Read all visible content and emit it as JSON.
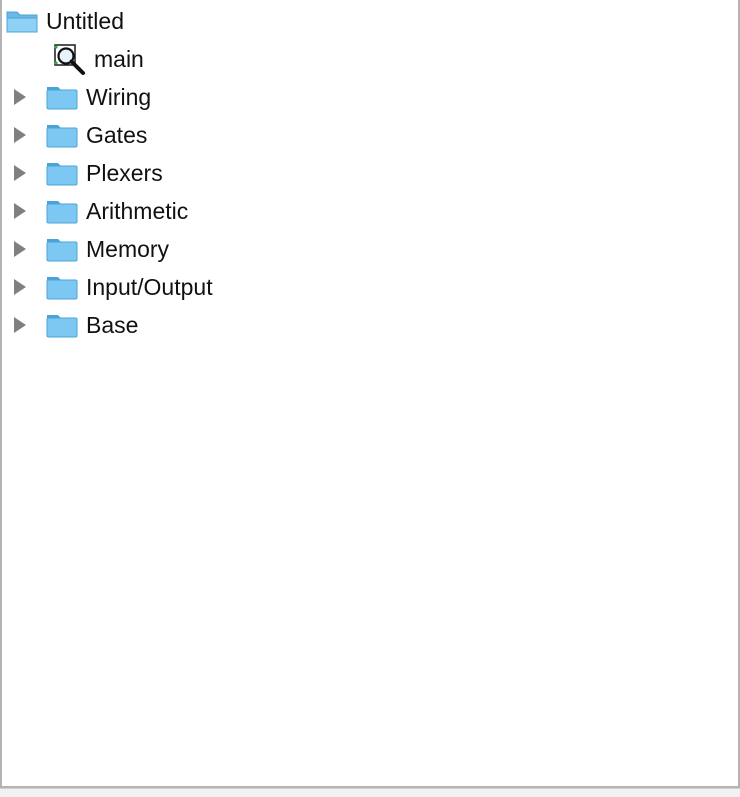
{
  "tree": {
    "root": {
      "label": "Untitled",
      "icon": "folder-open-icon"
    },
    "circuit": {
      "label": "main",
      "icon": "magnifier-circuit-icon"
    },
    "libraries": [
      {
        "label": "Wiring",
        "icon": "folder-icon"
      },
      {
        "label": "Gates",
        "icon": "folder-icon"
      },
      {
        "label": "Plexers",
        "icon": "folder-icon"
      },
      {
        "label": "Arithmetic",
        "icon": "folder-icon"
      },
      {
        "label": "Memory",
        "icon": "folder-icon"
      },
      {
        "label": "Input/Output",
        "icon": "folder-icon"
      },
      {
        "label": "Base",
        "icon": "folder-icon"
      }
    ]
  },
  "colors": {
    "folder_fill": "#7cc8f2",
    "folder_edge": "#4aa3d8",
    "expander": "#808080",
    "text": "#111111"
  }
}
